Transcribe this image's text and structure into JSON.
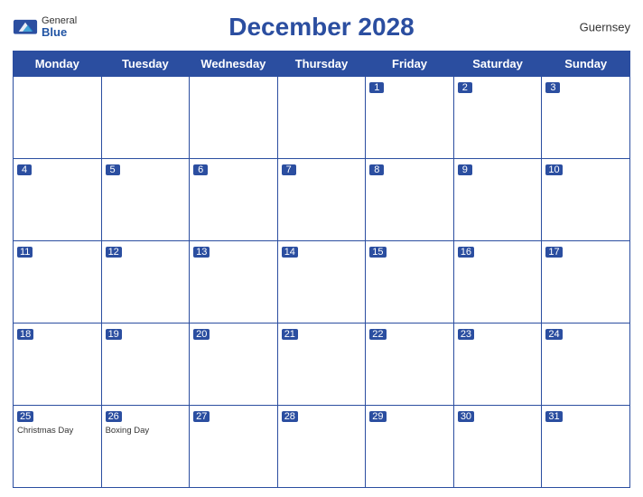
{
  "header": {
    "title": "December 2028",
    "country": "Guernsey",
    "logo_general": "General",
    "logo_blue": "Blue"
  },
  "weekdays": [
    "Monday",
    "Tuesday",
    "Wednesday",
    "Thursday",
    "Friday",
    "Saturday",
    "Sunday"
  ],
  "weeks": [
    [
      {
        "num": "",
        "empty": true
      },
      {
        "num": "",
        "empty": true
      },
      {
        "num": "",
        "empty": true
      },
      {
        "num": "",
        "empty": true
      },
      {
        "num": "1"
      },
      {
        "num": "2"
      },
      {
        "num": "3"
      }
    ],
    [
      {
        "num": "4"
      },
      {
        "num": "5"
      },
      {
        "num": "6"
      },
      {
        "num": "7"
      },
      {
        "num": "8"
      },
      {
        "num": "9"
      },
      {
        "num": "10"
      }
    ],
    [
      {
        "num": "11"
      },
      {
        "num": "12"
      },
      {
        "num": "13"
      },
      {
        "num": "14"
      },
      {
        "num": "15"
      },
      {
        "num": "16"
      },
      {
        "num": "17"
      }
    ],
    [
      {
        "num": "18"
      },
      {
        "num": "19"
      },
      {
        "num": "20"
      },
      {
        "num": "21"
      },
      {
        "num": "22"
      },
      {
        "num": "23"
      },
      {
        "num": "24"
      }
    ],
    [
      {
        "num": "25",
        "event": "Christmas Day"
      },
      {
        "num": "26",
        "event": "Boxing Day"
      },
      {
        "num": "27"
      },
      {
        "num": "28"
      },
      {
        "num": "29"
      },
      {
        "num": "30"
      },
      {
        "num": "31"
      }
    ]
  ]
}
